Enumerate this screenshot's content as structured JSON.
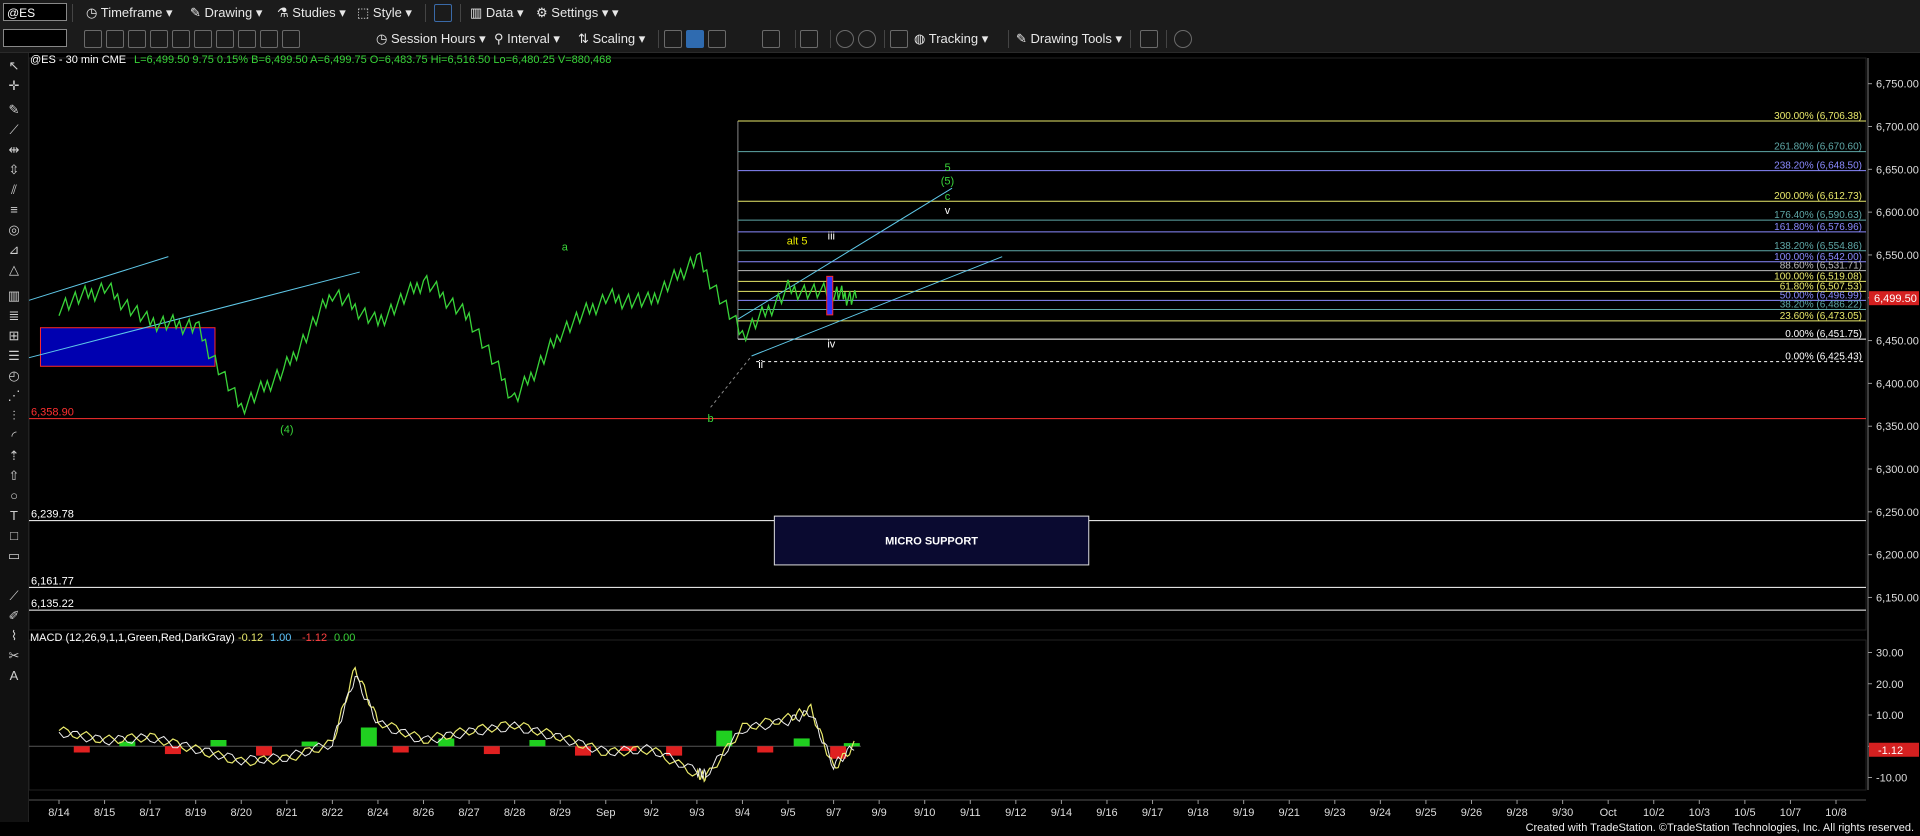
{
  "toolbar": {
    "symbol": "@ES",
    "timeframe": "Timeframe",
    "drawing": "Drawing",
    "studies": "Studies",
    "style": "Style",
    "data": "Data",
    "settings": "Settings",
    "session_hours": "Session Hours",
    "interval": "Interval",
    "scaling": "Scaling",
    "tracking": "Tracking",
    "drawing_tools": "Drawing Tools"
  },
  "chart_data": [
    {
      "type": "line",
      "title": "@ES - 30 min  CME",
      "header_quote": "L=6,499.50  9.75   0.15%  B=6,499.50  A=6,499.75  O=6,483.75  Hi=6,516.50  Lo=6,480.25  V=880,468",
      "x_ticks": [
        "8/14",
        "8/15",
        "8/17",
        "8/19",
        "8/20",
        "8/21",
        "8/22",
        "8/24",
        "8/26",
        "8/27",
        "8/28",
        "8/29",
        "Sep",
        "9/2",
        "9/3",
        "9/4",
        "9/5",
        "9/7",
        "9/9",
        "9/10",
        "9/11",
        "9/12",
        "9/14",
        "9/16",
        "9/17",
        "9/18",
        "9/19",
        "9/21",
        "9/23",
        "9/24",
        "9/25",
        "9/26",
        "9/28",
        "9/30",
        "Oct",
        "10/2",
        "10/3",
        "10/5",
        "10/7",
        "10/8"
      ],
      "ylim": [
        6112,
        6780
      ],
      "y_ticks": [
        6150,
        6200,
        6250,
        6300,
        6350,
        6400,
        6450,
        6500,
        6550,
        6600,
        6650,
        6700,
        6750
      ],
      "y_tick_labels": [
        "6,150.00",
        "6,200.00",
        "6,250.00",
        "6,300.00",
        "6,350.00",
        "6,400.00",
        "6,450.00",
        "6,500.00",
        "6,550.00",
        "6,600.00",
        "6,650.00",
        "6,700.00",
        "6,750.00"
      ],
      "price_series": {
        "name": "ES 30 min",
        "x": [
          0,
          1,
          2,
          3,
          4,
          5,
          6,
          7,
          8,
          9,
          10,
          11,
          12,
          13,
          14,
          15,
          16,
          17,
          17.5
        ],
        "values": [
          6490,
          6512,
          6470,
          6468,
          6370,
          6420,
          6505,
          6472,
          6520,
          6478,
          6380,
          6460,
          6500,
          6495,
          6548,
          6455,
          6510,
          6505,
          6499.5
        ]
      },
      "last_price_label": "6,499.50",
      "levels": [
        {
          "value": 6706.38,
          "label": "300.00% (6,706.38)",
          "color": "#e8e86a"
        },
        {
          "value": 6670.6,
          "label": "261.80% (6,670.60)",
          "color": "#5fa8a8"
        },
        {
          "value": 6648.5,
          "label": "238.20% (6,648.50)",
          "color": "#8a8aff"
        },
        {
          "value": 6612.73,
          "label": "200.00% (6,612.73)",
          "color": "#e8e86a"
        },
        {
          "value": 6590.63,
          "label": "176.40% (6,590.63)",
          "color": "#5fa8a8"
        },
        {
          "value": 6576.96,
          "label": "161.80% (6,576.96)",
          "color": "#8a8aff"
        },
        {
          "value": 6554.86,
          "label": "138.20% (6,554.86)",
          "color": "#5fa8a8"
        },
        {
          "value": 6542.0,
          "label": "100.00% (6,542.00)",
          "color": "#8a8aff"
        },
        {
          "value": 6531.71,
          "label": "88.60% (6,531.71)",
          "color": "#bbbbbb"
        },
        {
          "value": 6519.08,
          "label": "100.00% (6,519.08)",
          "color": "#e8e86a"
        },
        {
          "value": 6507.53,
          "label": "61.80% (6,507.53)",
          "color": "#e8e86a"
        },
        {
          "value": 6496.99,
          "label": "50.00% (6,496.99)",
          "color": "#8a8aff"
        },
        {
          "value": 6486.22,
          "label": "38.20% (6,486.22)",
          "color": "#5fa8a8"
        },
        {
          "value": 6473.05,
          "label": "23.60% (6,473.05)",
          "color": "#e8e86a"
        },
        {
          "value": 6451.75,
          "label": "0.00% (6,451.75)",
          "color": "#ffffff"
        },
        {
          "value": 6425.43,
          "label": "0.00% (6,425.43)",
          "color": "#ffffff"
        }
      ],
      "support_lines": [
        {
          "value": 6358.9,
          "label": "6,358.90",
          "color": "#ff3030"
        },
        {
          "value": 6239.78,
          "label": "6,239.78",
          "color": "#ffffff"
        },
        {
          "value": 6161.77,
          "label": "6,161.77",
          "color": "#ffffff"
        },
        {
          "value": 6135.22,
          "label": "6,135.22",
          "color": "#ffffff"
        }
      ],
      "micro_support_box": {
        "label": "MICRO SUPPORT",
        "from_x": 15.7,
        "to_x": 22.6,
        "top": 6245,
        "bottom": 6188
      },
      "left_blue_box": {
        "from_x": 0.12,
        "to_x": 3.95,
        "top": 6465,
        "bottom": 6420
      },
      "wave_labels": [
        {
          "text": "a",
          "x": 11.1,
          "y": 6555,
          "color": "#39d439"
        },
        {
          "text": "(4)",
          "x": 5.0,
          "y": 6342,
          "color": "#39d439"
        },
        {
          "text": "b",
          "x": 14.3,
          "y": 6355,
          "color": "#39d439"
        },
        {
          "text": "alt 5",
          "x": 16.2,
          "y": 6562,
          "color": "#e8e800"
        },
        {
          "text": "iii",
          "x": 16.95,
          "y": 6568,
          "color": "#ffffff"
        },
        {
          "text": "ii",
          "x": 15.4,
          "y": 6418,
          "color": "#ffffff"
        },
        {
          "text": "iv",
          "x": 16.95,
          "y": 6442,
          "color": "#ffffff"
        },
        {
          "text": "5",
          "x": 19.5,
          "y": 6648,
          "color": "#39d439"
        },
        {
          "text": "(5)",
          "x": 19.5,
          "y": 6632,
          "color": "#39d439"
        },
        {
          "text": "c",
          "x": 19.5,
          "y": 6614,
          "color": "#39d439"
        },
        {
          "text": "v",
          "x": 19.5,
          "y": 6598,
          "color": "#ffffff"
        }
      ]
    },
    {
      "type": "line",
      "title": "MACD (12,26,9,1,1,Green,Red,DarkGray)",
      "values_label": [
        "-0.12",
        "1.00",
        "-1.12",
        "0.00"
      ],
      "values_colors": [
        "#e8e86a",
        "#5fc8ff",
        "#ff4040",
        "#39d439"
      ],
      "ylim": [
        -14,
        34
      ],
      "y_ticks": [
        30,
        20,
        10,
        0,
        -10
      ],
      "y_tick_labels": [
        "30.00",
        "20.00",
        "10.00",
        "0.00",
        "-10.00"
      ],
      "last_value_label": "-1.12",
      "macd_series": {
        "name": "MACD",
        "x": [
          0,
          1,
          2,
          3,
          4,
          5,
          6,
          6.5,
          7,
          8,
          9,
          10,
          11,
          12,
          13,
          14,
          14.2,
          15,
          16,
          16.5,
          17,
          17.5
        ],
        "values": [
          5,
          2,
          3,
          -1,
          -5,
          -4,
          1,
          25,
          8,
          2,
          5,
          7,
          3,
          -2,
          -1,
          -9,
          -10,
          6,
          9,
          12,
          -7,
          1
        ]
      },
      "histogram": {
        "x": [
          0.5,
          1.5,
          2.5,
          3.5,
          4.5,
          5.5,
          6.8,
          7.5,
          8.5,
          9.5,
          10.5,
          11.5,
          12.5,
          13.5,
          14.6,
          15.5,
          16.3,
          17.1,
          17.4
        ],
        "values": [
          -2,
          1.5,
          -2.5,
          2,
          -3,
          1.5,
          6,
          -2,
          2.5,
          -2.5,
          2,
          -3,
          -1.5,
          -3,
          5,
          -2,
          2.5,
          -4,
          1
        ]
      }
    }
  ],
  "footer": {
    "credit": "Created with TradeStation. ©TradeStation Technologies, Inc. All rights reserved."
  }
}
